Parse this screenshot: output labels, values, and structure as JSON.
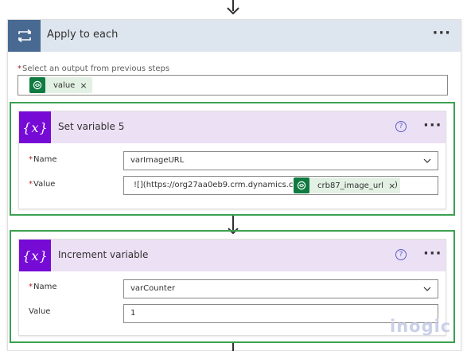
{
  "loop": {
    "title": "Apply to each",
    "more_label": "···",
    "select_label_required": "*",
    "select_label": "Select an output from previous steps",
    "token": {
      "label": "value",
      "remove": "×"
    }
  },
  "set_variable": {
    "title": "Set variable 5",
    "help": "?",
    "more_label": "···",
    "name_required": "*",
    "name_label": "Name",
    "name_value": "varImageURL",
    "value_required": "*",
    "value_label": "Value",
    "value_prefix": "![](https://org27aa0eb9.crm.dynamics.com",
    "value_token": "crb87_image_url",
    "value_token_remove": "×",
    "value_suffix": ")"
  },
  "increment_variable": {
    "title": "Increment variable",
    "help": "?",
    "more_label": "···",
    "name_required": "*",
    "name_label": "Name",
    "name_value": "varCounter",
    "value_label": "Value",
    "value_value": "1"
  },
  "watermark": "inogic",
  "colors": {
    "loop_header": "#dde5ee",
    "loop_icon": "#486991",
    "action_header": "#ece0f5",
    "variable_icon": "#770bd6",
    "highlight_border": "#3ca151",
    "token_icon": "#0f7b41"
  },
  "icons": [
    "loop-icon",
    "variable-icon",
    "dataverse-icon",
    "help-icon",
    "chevron-down-icon",
    "more-icon"
  ]
}
